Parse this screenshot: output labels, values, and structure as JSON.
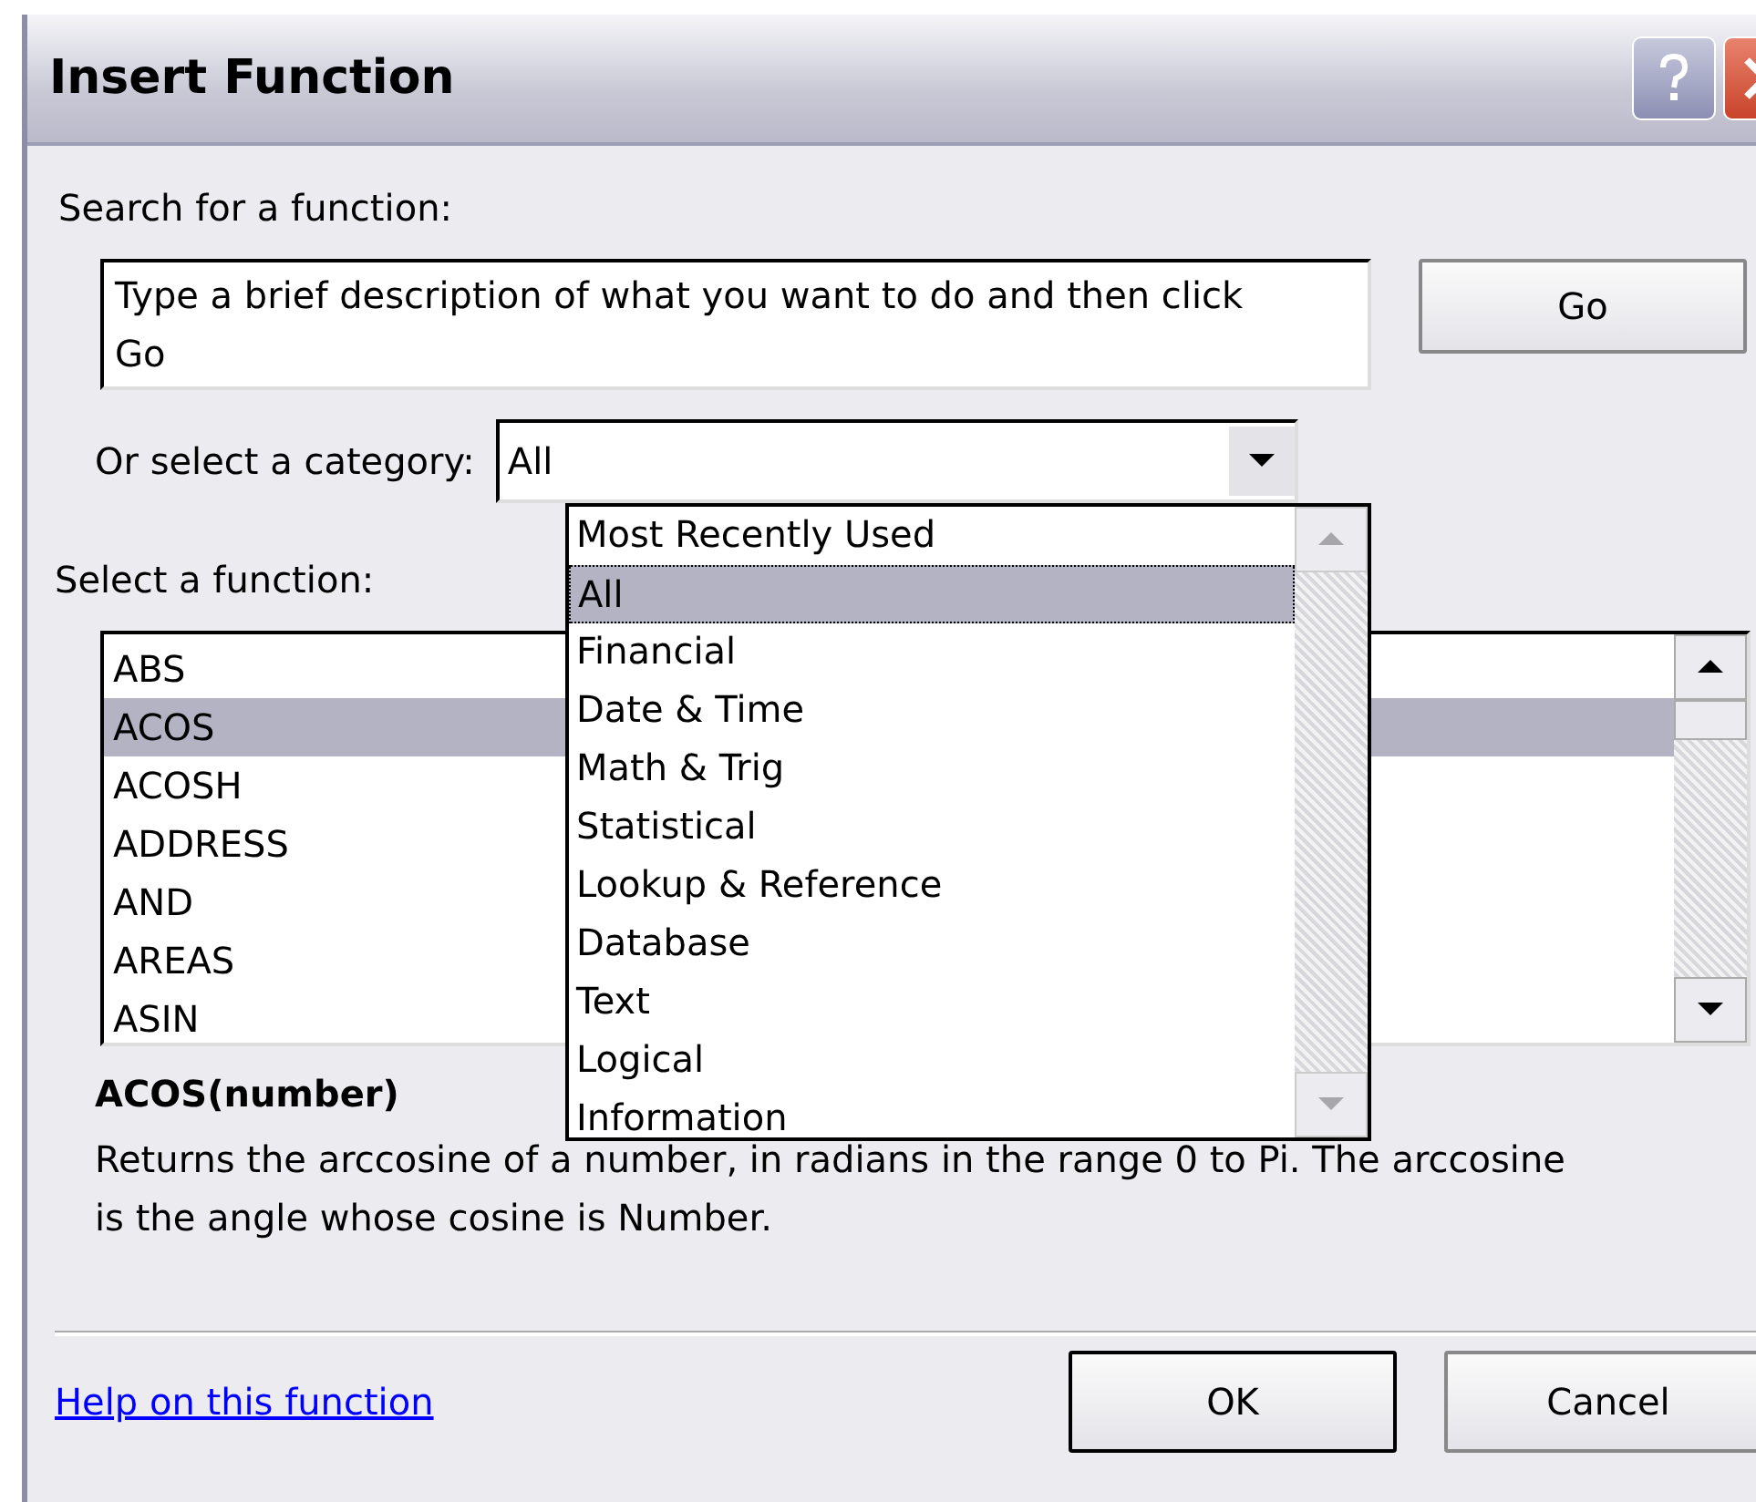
{
  "window": {
    "title": "Insert Function"
  },
  "search": {
    "label": "Search for a function:",
    "value": "Type a brief description of what you want to do and then click Go"
  },
  "go_button": "Go",
  "category": {
    "label": "Or select a category:",
    "value": "All",
    "expanded": true,
    "options": [
      {
        "label": "Most Recently Used",
        "selected": false
      },
      {
        "label": "All",
        "selected": true
      },
      {
        "label": "Financial",
        "selected": false
      },
      {
        "label": "Date & Time",
        "selected": false
      },
      {
        "label": "Math & Trig",
        "selected": false
      },
      {
        "label": "Statistical",
        "selected": false
      },
      {
        "label": "Lookup & Reference",
        "selected": false
      },
      {
        "label": "Database",
        "selected": false
      },
      {
        "label": "Text",
        "selected": false
      },
      {
        "label": "Logical",
        "selected": false
      },
      {
        "label": "Information",
        "selected": false
      }
    ]
  },
  "function_list": {
    "label": "Select a function:",
    "items": [
      {
        "label": "ABS",
        "selected": false
      },
      {
        "label": "ACOS",
        "selected": true
      },
      {
        "label": "ACOSH",
        "selected": false
      },
      {
        "label": "ADDRESS",
        "selected": false
      },
      {
        "label": "AND",
        "selected": false
      },
      {
        "label": "AREAS",
        "selected": false
      },
      {
        "label": "ASIN",
        "selected": false
      }
    ]
  },
  "signature": "ACOS(number)",
  "description": "Returns the arccosine of a number, in radians in the range 0 to Pi. The arccosine is the angle whose cosine is Number.",
  "help_link": "Help on this function",
  "buttons": [
    "OK",
    "Cancel"
  ]
}
